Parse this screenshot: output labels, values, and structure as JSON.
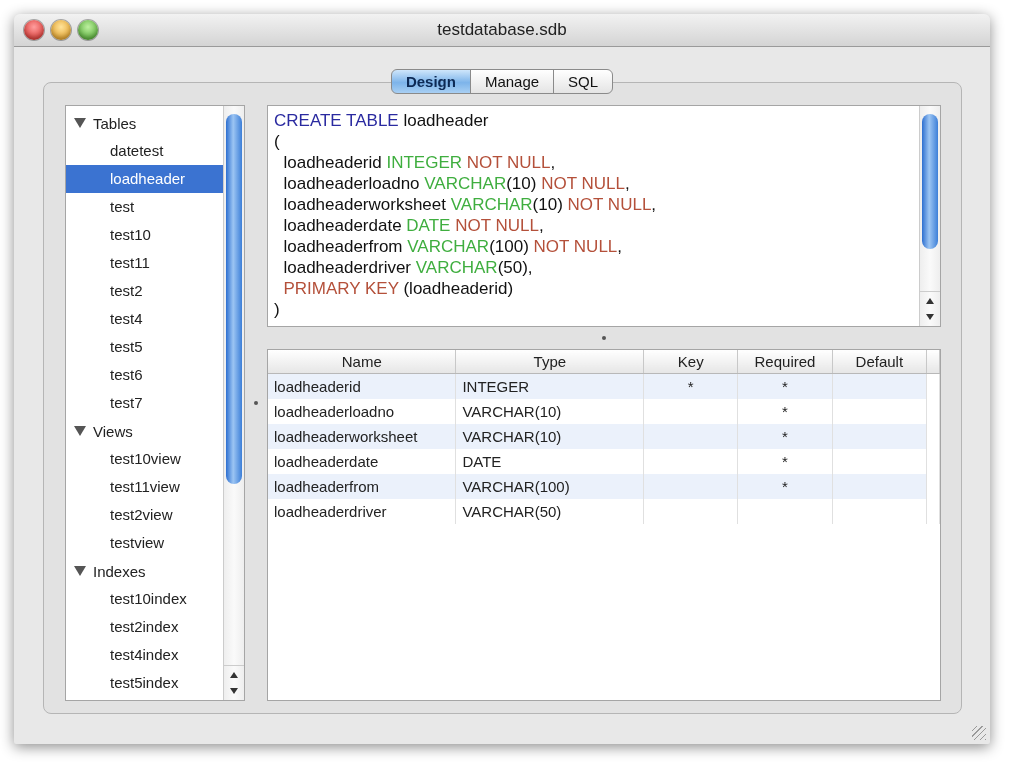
{
  "window": {
    "title": "testdatabase.sdb"
  },
  "tabs": [
    {
      "label": "Design",
      "selected": true
    },
    {
      "label": "Manage",
      "selected": false
    },
    {
      "label": "SQL",
      "selected": false
    }
  ],
  "sidebar": {
    "groups": [
      {
        "label": "Tables",
        "expanded": true,
        "children": [
          {
            "label": "datetest",
            "selected": false
          },
          {
            "label": "loadheader",
            "selected": true
          },
          {
            "label": "test",
            "selected": false
          },
          {
            "label": "test10",
            "selected": false
          },
          {
            "label": "test11",
            "selected": false
          },
          {
            "label": "test2",
            "selected": false
          },
          {
            "label": "test4",
            "selected": false
          },
          {
            "label": "test5",
            "selected": false
          },
          {
            "label": "test6",
            "selected": false
          },
          {
            "label": "test7",
            "selected": false
          }
        ]
      },
      {
        "label": "Views",
        "expanded": true,
        "children": [
          {
            "label": "test10view",
            "selected": false
          },
          {
            "label": "test11view",
            "selected": false
          },
          {
            "label": "test2view",
            "selected": false
          },
          {
            "label": "testview",
            "selected": false
          }
        ]
      },
      {
        "label": "Indexes",
        "expanded": true,
        "children": [
          {
            "label": "test10index",
            "selected": false
          },
          {
            "label": "test2index",
            "selected": false
          },
          {
            "label": "test4index",
            "selected": false
          },
          {
            "label": "test5index",
            "selected": false
          }
        ]
      }
    ]
  },
  "sql_lines": [
    [
      {
        "kind": "keyword",
        "text": "CREATE TABLE"
      },
      {
        "kind": "plain",
        "text": " loadheader"
      }
    ],
    [
      {
        "kind": "plain",
        "text": "("
      }
    ],
    [
      {
        "kind": "plain",
        "text": "  loadheaderid "
      },
      {
        "kind": "type",
        "text": "INTEGER"
      },
      {
        "kind": "constraint",
        "text": " NOT NULL"
      },
      {
        "kind": "plain",
        "text": ","
      }
    ],
    [
      {
        "kind": "plain",
        "text": "  loadheaderloadno "
      },
      {
        "kind": "type",
        "text": "VARCHAR"
      },
      {
        "kind": "plain",
        "text": "(10)"
      },
      {
        "kind": "constraint",
        "text": " NOT NULL"
      },
      {
        "kind": "plain",
        "text": ","
      }
    ],
    [
      {
        "kind": "plain",
        "text": "  loadheaderworksheet "
      },
      {
        "kind": "type",
        "text": "VARCHAR"
      },
      {
        "kind": "plain",
        "text": "(10)"
      },
      {
        "kind": "constraint",
        "text": " NOT NULL"
      },
      {
        "kind": "plain",
        "text": ","
      }
    ],
    [
      {
        "kind": "plain",
        "text": "  loadheaderdate "
      },
      {
        "kind": "type",
        "text": "DATE"
      },
      {
        "kind": "constraint",
        "text": " NOT NULL"
      },
      {
        "kind": "plain",
        "text": ","
      }
    ],
    [
      {
        "kind": "plain",
        "text": "  loadheaderfrom "
      },
      {
        "kind": "type",
        "text": "VARCHAR"
      },
      {
        "kind": "plain",
        "text": "(100)"
      },
      {
        "kind": "constraint",
        "text": " NOT NULL"
      },
      {
        "kind": "plain",
        "text": ","
      }
    ],
    [
      {
        "kind": "plain",
        "text": "  loadheaderdriver "
      },
      {
        "kind": "type",
        "text": "VARCHAR"
      },
      {
        "kind": "plain",
        "text": "(50),"
      }
    ],
    [
      {
        "kind": "constraint",
        "text": "  PRIMARY KEY"
      },
      {
        "kind": "plain",
        "text": " (loadheaderid)"
      }
    ],
    [
      {
        "kind": "plain",
        "text": ")"
      }
    ]
  ],
  "table": {
    "columns": [
      "Name",
      "Type",
      "Key",
      "Required",
      "Default"
    ],
    "rows": [
      [
        "loadheaderid",
        "INTEGER",
        "*",
        "*",
        ""
      ],
      [
        "loadheaderloadno",
        "VARCHAR(10)",
        "",
        "*",
        ""
      ],
      [
        "loadheaderworksheet",
        "VARCHAR(10)",
        "",
        "*",
        ""
      ],
      [
        "loadheaderdate",
        "DATE",
        "",
        "*",
        ""
      ],
      [
        "loadheaderfrom",
        "VARCHAR(100)",
        "",
        "*",
        ""
      ],
      [
        "loadheaderdriver",
        "VARCHAR(50)",
        "",
        "",
        ""
      ]
    ]
  }
}
